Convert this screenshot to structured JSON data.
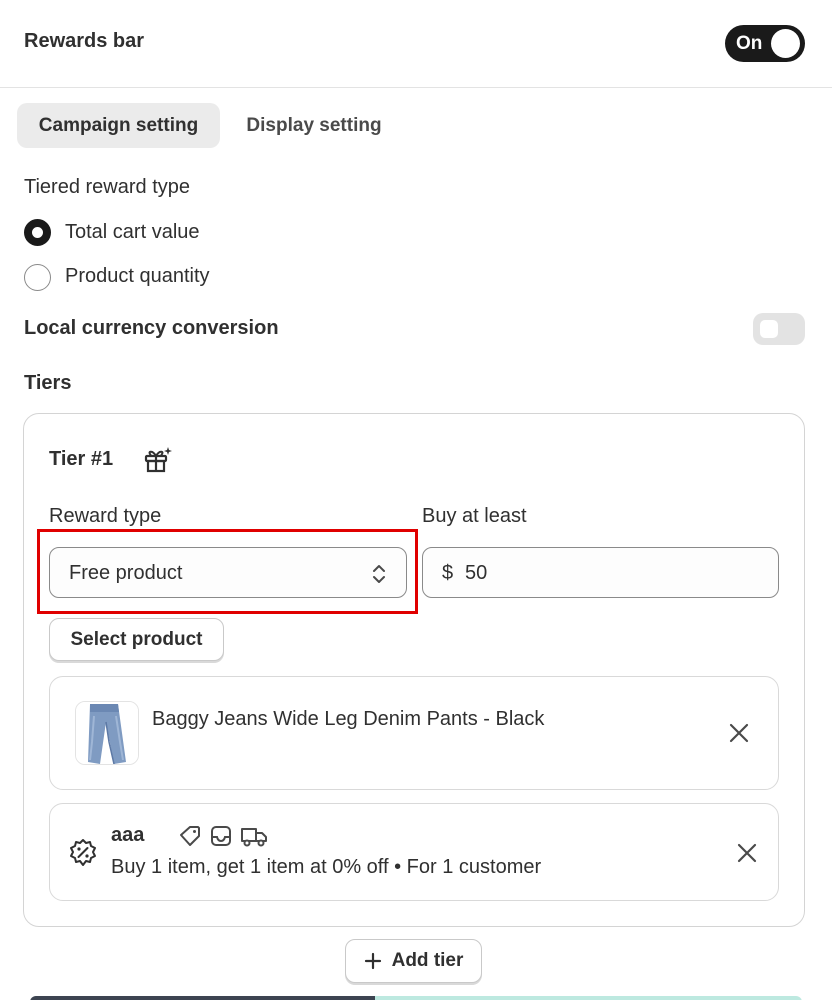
{
  "header": {
    "title": "Rewards bar",
    "toggle_label": "On"
  },
  "tabs": [
    {
      "label": "Campaign setting",
      "active": true
    },
    {
      "label": "Display setting",
      "active": false
    }
  ],
  "reward_type_section": {
    "label": "Tiered reward type",
    "options": [
      {
        "label": "Total cart value",
        "checked": true
      },
      {
        "label": "Product quantity",
        "checked": false
      }
    ]
  },
  "currency": {
    "label": "Local currency conversion",
    "enabled": false
  },
  "tiers_label": "Tiers",
  "tier": {
    "title": "Tier #1",
    "reward_type_label": "Reward type",
    "reward_type_value": "Free product",
    "buy_label": "Buy at least",
    "currency_prefix": "$",
    "buy_value": "50",
    "select_product_label": "Select product",
    "product": {
      "name": "Baggy Jeans Wide Leg Denim Pants - Black"
    },
    "discount": {
      "title": "aaa",
      "description": "Buy 1 item, get 1 item at 0% off • For 1 customer"
    }
  },
  "add_tier_label": "Add tier",
  "colors": {
    "accent": "#1a1a1a",
    "highlight": "#e00000",
    "bar_dark": "#3d4451",
    "bar_light": "#bde9e0"
  }
}
